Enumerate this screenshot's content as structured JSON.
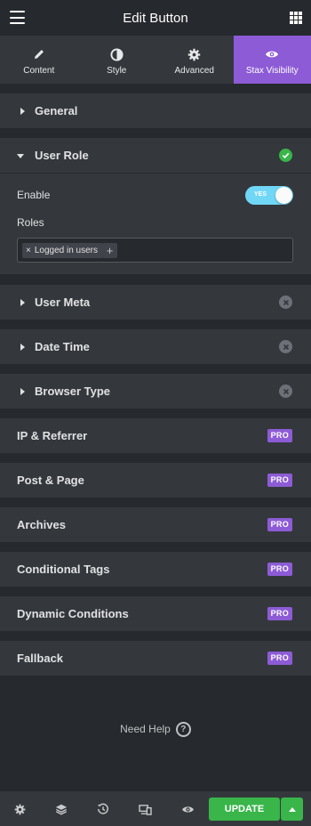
{
  "header": {
    "title": "Edit Button"
  },
  "tabs": [
    {
      "label": "Content",
      "icon": "pencil-icon"
    },
    {
      "label": "Style",
      "icon": "contrast-icon"
    },
    {
      "label": "Advanced",
      "icon": "gear-icon"
    },
    {
      "label": "Stax Visibility",
      "icon": "eye-icon",
      "active": true
    }
  ],
  "sections": {
    "general": "General",
    "user_role": "User Role",
    "user_meta": "User Meta",
    "date_time": "Date Time",
    "browser_type": "Browser Type",
    "ip_referrer": "IP & Referrer",
    "post_page": "Post & Page",
    "archives": "Archives",
    "conditional_tags": "Conditional Tags",
    "dynamic_conditions": "Dynamic Conditions",
    "fallback": "Fallback"
  },
  "pro_badge": "PRO",
  "user_role": {
    "enable_label": "Enable",
    "enable_state": "YES",
    "roles_label": "Roles",
    "roles": [
      "Logged in users"
    ],
    "remove_glyph": "×",
    "add_glyph": "+"
  },
  "help": {
    "label": "Need Help",
    "icon_glyph": "?"
  },
  "footer": {
    "update_label": "UPDATE"
  },
  "colors": {
    "accent": "#8d5bd6",
    "success": "#39b54a",
    "toggle_on": "#71d7f7",
    "panel": "#34383c",
    "background": "#26292d"
  }
}
